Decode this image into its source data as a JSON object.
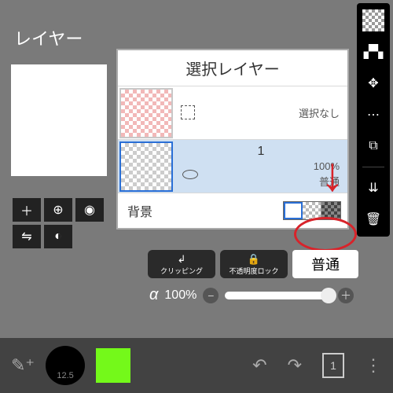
{
  "title": "レイヤー",
  "layer_panel": {
    "header": "選択レイヤー",
    "rows": [
      {
        "name": "",
        "status": "選択なし"
      },
      {
        "name": "1",
        "opacity": "100%",
        "blend": "普通"
      }
    ],
    "bg_label": "背景"
  },
  "pills": {
    "clipping": "クリッピング",
    "alpha_lock": "不透明度ロック"
  },
  "blend_select": "普通",
  "alpha": {
    "label": "α",
    "value": "100%"
  },
  "bottom": {
    "brush_size": "12.5",
    "layer_num": "1"
  }
}
